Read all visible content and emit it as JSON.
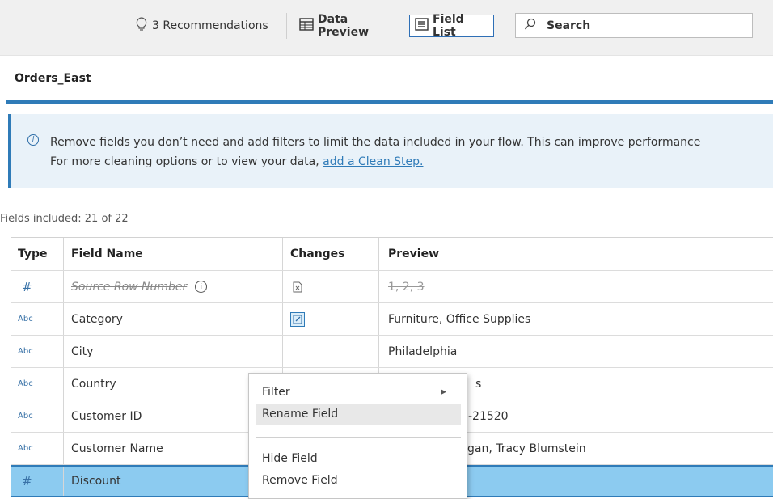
{
  "toolbar": {
    "recommendations": "3 Recommendations",
    "data_preview": "Data Preview",
    "field_list": "Field List",
    "search_placeholder": "Search"
  },
  "title": "Orders_East",
  "info": {
    "line1": "Remove fields you don’t need and add filters to limit the data included in your flow. This can improve performance",
    "line2_prefix": "For more cleaning options or to view your data, ",
    "line2_link": "add a Clean Step."
  },
  "fields_included": "Fields included: 21 of 22",
  "table": {
    "headers": {
      "type": "Type",
      "field_name": "Field Name",
      "changes": "Changes",
      "preview": "Preview"
    },
    "rows": [
      {
        "type": "#",
        "name": "Source Row Number",
        "preview": "1, 2, 3"
      },
      {
        "type": "Abc",
        "name": "Category",
        "preview": "Furniture, Office Supplies"
      },
      {
        "type": "Abc",
        "name": "City",
        "preview": "Philadelphia"
      },
      {
        "type": "Abc",
        "name": "Country",
        "preview": "s"
      },
      {
        "type": "Abc",
        "name": "Customer ID",
        "preview": "-21520"
      },
      {
        "type": "Abc",
        "name": "Customer Name",
        "preview": "gan, Tracy Blumstein"
      },
      {
        "type": "#",
        "name": "Discount",
        "preview": ""
      }
    ]
  },
  "context_menu": {
    "filter": "Filter",
    "rename": "Rename Field",
    "hide": "Hide Field",
    "remove": "Remove Field"
  },
  "colors": {
    "accent": "#2f7bb8",
    "selected_row": "#8ccbf0",
    "banner_bg": "#e9f2f9"
  }
}
